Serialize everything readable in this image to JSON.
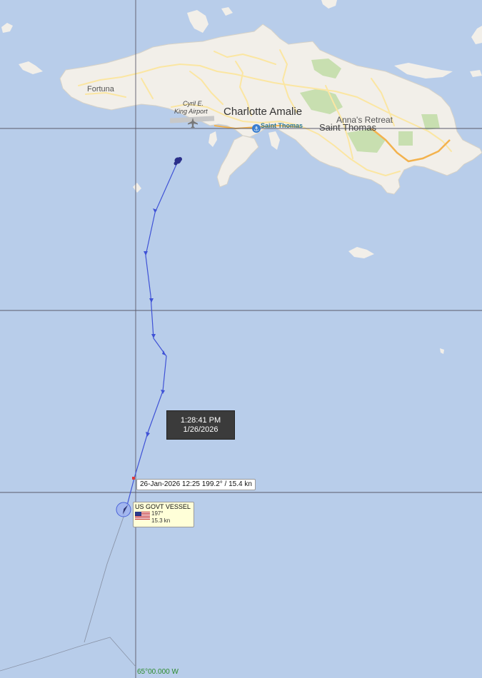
{
  "map": {
    "place_labels": {
      "fortuna": "Fortuna",
      "airport_line1": "Cyril E.",
      "airport_line2": "King Airport",
      "charlotte_amalie": "Charlotte Amalie",
      "port": "Saint Thomas",
      "annas_retreat": "Anna's Retreat",
      "saint_thomas": "Saint Thomas"
    },
    "longitude_label": "65°00.000 W",
    "colors": {
      "water": "#b8cdea",
      "land": "#f2efe9",
      "park": "#c8dfb0",
      "track": "#3f52d6",
      "gridline": "#5a5a6a"
    }
  },
  "track_tooltip": {
    "time": "1:28:41 PM",
    "date": "1/26/2026"
  },
  "position_report": {
    "text": "26-Jan-2026 12:25  199.2° / 15.4 kn"
  },
  "vessel": {
    "name": "US GOVT VESSEL",
    "flag": "us-flag-icon",
    "course": "197°",
    "speed": "15.3 kn"
  }
}
